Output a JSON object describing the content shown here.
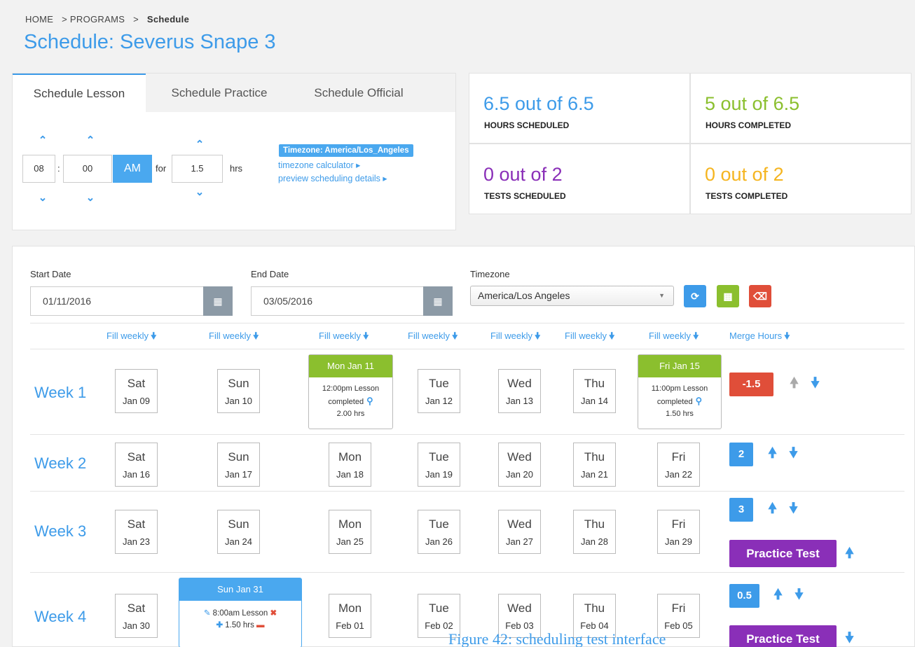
{
  "breadcrumb": {
    "home": "HOME",
    "programs": "> PROGRAMS",
    "sep": ">",
    "current": "Schedule"
  },
  "page_title": "Schedule: Severus Snape 3",
  "tabs": [
    {
      "label": "Schedule Lesson",
      "active": true
    },
    {
      "label": "Schedule Practice",
      "active": false
    },
    {
      "label": "Schedule Official",
      "active": false
    }
  ],
  "time_picker": {
    "hour": "08",
    "colon": ":",
    "minute": "00",
    "ampm": "AM",
    "for_label": "for",
    "duration": "1.5",
    "hrs_label": "hrs",
    "up_icon": "chevron-up-icon",
    "down_icon": "chevron-down-icon"
  },
  "timezone_info": {
    "badge": "Timezone: America/Los_Angeles",
    "calculator_link": "timezone calculator ▸",
    "preview_link": "preview scheduling details ▸"
  },
  "stats": [
    {
      "value": "6.5 out of 6.5",
      "caption": "HOURS SCHEDULED",
      "color": "#3d9be9"
    },
    {
      "value": "5 out of 6.5",
      "caption": "HOURS COMPLETED",
      "color": "#8bbf2e"
    },
    {
      "value": "0 out of 2",
      "caption": "TESTS SCHEDULED",
      "color": "#8a2fb8"
    },
    {
      "value": "0 out of 2",
      "caption": "TESTS COMPLETED",
      "color": "#f5b520"
    }
  ],
  "filters": {
    "start_label": "Start Date",
    "start_value": "01/11/2016",
    "end_label": "End Date",
    "end_value": "03/05/2016",
    "tz_label": "Timezone",
    "tz_value": "America/Los Angeles",
    "refresh_color": "#3d9be9",
    "save_color": "#8bbf2e",
    "delete_color": "#e04e39"
  },
  "fill_weekly": [
    "Fill weekly",
    "Fill weekly",
    "Fill weekly",
    "Fill weekly",
    "Fill weekly",
    "Fill weekly",
    "Fill weekly"
  ],
  "merge_hours": "Merge Hours",
  "weeks": [
    {
      "label": "Week 1",
      "badge": "-1.5",
      "badge_color": "#e04e39",
      "days": [
        {
          "name": "Sat",
          "date": "Jan 09"
        },
        {
          "name": "Sun",
          "date": "Jan 10"
        },
        {
          "name": "Mon Jan 11",
          "event": true
        },
        {
          "name": "Tue",
          "date": "Jan 12"
        },
        {
          "name": "Wed",
          "date": "Jan 13"
        },
        {
          "name": "Thu",
          "date": "Jan 14"
        },
        {
          "name": "Fri Jan 15",
          "event": true
        }
      ],
      "events": [
        {
          "header": "Mon Jan 11",
          "line1": "12:00pm Lesson",
          "line2": "completed",
          "line3": "2.00 hrs"
        },
        {
          "header": "Fri Jan 15",
          "line1": "11:00pm Lesson",
          "line2": "completed",
          "line3": "1.50 hrs"
        }
      ]
    },
    {
      "label": "Week 2",
      "badge": "2",
      "badge_color": "#3d9be9",
      "days": [
        {
          "name": "Sat",
          "date": "Jan 16"
        },
        {
          "name": "Sun",
          "date": "Jan 17"
        },
        {
          "name": "Mon",
          "date": "Jan 18"
        },
        {
          "name": "Tue",
          "date": "Jan 19"
        },
        {
          "name": "Wed",
          "date": "Jan 20"
        },
        {
          "name": "Thu",
          "date": "Jan 21"
        },
        {
          "name": "Fri",
          "date": "Jan 22"
        }
      ]
    },
    {
      "label": "Week 3",
      "badge": "3",
      "badge_color": "#3d9be9",
      "practice_test": "Practice Test",
      "days": [
        {
          "name": "Sat",
          "date": "Jan 23"
        },
        {
          "name": "Sun",
          "date": "Jan 24"
        },
        {
          "name": "Mon",
          "date": "Jan 25"
        },
        {
          "name": "Tue",
          "date": "Jan 26"
        },
        {
          "name": "Wed",
          "date": "Jan 27"
        },
        {
          "name": "Thu",
          "date": "Jan 28"
        },
        {
          "name": "Fri",
          "date": "Jan 29"
        }
      ]
    },
    {
      "label": "Week 4",
      "badge": "0.5",
      "badge_color": "#3d9be9",
      "practice_test": "Practice Test",
      "days": [
        {
          "name": "Sat",
          "date": "Jan 30"
        },
        {
          "name": "Sun Jan 31",
          "event": true
        },
        {
          "name": "Mon",
          "date": "Feb 01"
        },
        {
          "name": "Tue",
          "date": "Feb 02"
        },
        {
          "name": "Wed",
          "date": "Feb 03"
        },
        {
          "name": "Thu",
          "date": "Feb 04"
        },
        {
          "name": "Fri",
          "date": "Feb 05"
        }
      ],
      "events": [
        {
          "header": "Sun Jan 31",
          "line1": "8:00am Lesson",
          "line2": "1.50 hrs"
        }
      ]
    }
  ],
  "caption": "Figure 42: scheduling test interface"
}
